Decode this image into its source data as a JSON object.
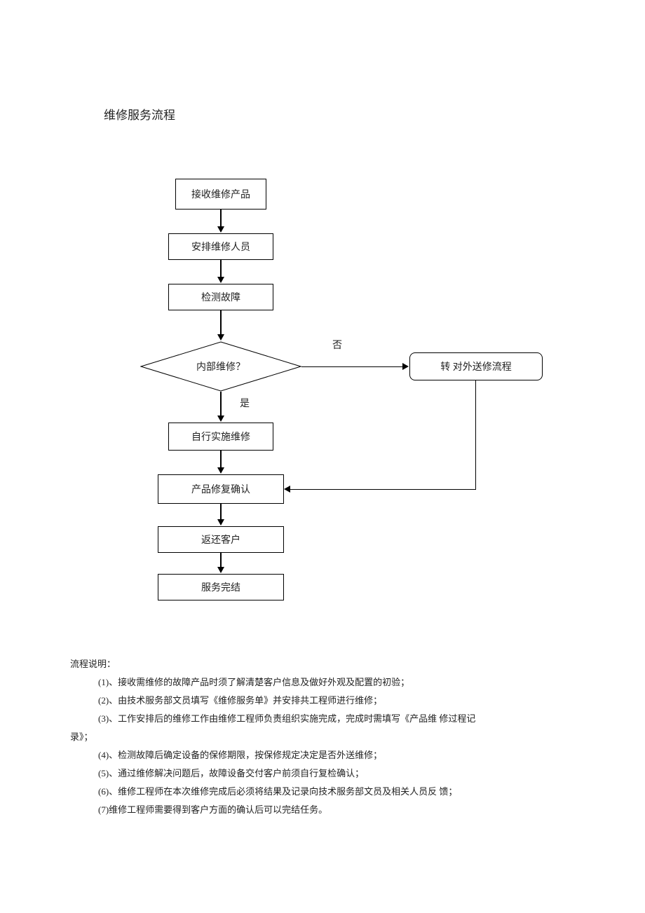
{
  "title": "维修服务流程",
  "chart_data": {
    "type": "flowchart",
    "nodes": [
      {
        "id": "n1",
        "kind": "process",
        "label": "接收维修产品"
      },
      {
        "id": "n2",
        "kind": "process",
        "label": "安排维修人员"
      },
      {
        "id": "n3",
        "kind": "process",
        "label": "检测故障"
      },
      {
        "id": "n4",
        "kind": "decision",
        "label": "内部维修？"
      },
      {
        "id": "n5",
        "kind": "process-rounded",
        "label": "转  对外送修流程"
      },
      {
        "id": "n6",
        "kind": "process",
        "label": "自行实施维修"
      },
      {
        "id": "n7",
        "kind": "process",
        "label": "产品修复确认"
      },
      {
        "id": "n8",
        "kind": "process",
        "label": "返还客户"
      },
      {
        "id": "n9",
        "kind": "process",
        "label": "服务完结"
      }
    ],
    "edges": [
      {
        "from": "n1",
        "to": "n2"
      },
      {
        "from": "n2",
        "to": "n3"
      },
      {
        "from": "n3",
        "to": "n4"
      },
      {
        "from": "n4",
        "to": "n6",
        "label": "是"
      },
      {
        "from": "n4",
        "to": "n5",
        "label": "否"
      },
      {
        "from": "n6",
        "to": "n7"
      },
      {
        "from": "n5",
        "to": "n7"
      },
      {
        "from": "n7",
        "to": "n8"
      },
      {
        "from": "n8",
        "to": "n9"
      }
    ],
    "labels": {
      "yes": "是",
      "no": "否"
    }
  },
  "notes": {
    "heading": "流程说明：",
    "items": [
      "(1)、接收需维修的故障产品时须了解清楚客户信息及做好外观及配置的初验；",
      "(2)、由技术服务部文员填写《维修服务单》并安排共工程师进行维修；",
      "(3)、工作安排后的维修工作由维修工程师负责组织实施完成，完成时需填写《产品维  修过程记",
      "(4)、检测故障后确定设备的保修期限，按保修规定决定是否外送维修；",
      "(5)、通过维修解决问题后，故障设备交付客户前须自行复检确认；",
      "(6)、维修工程师在本次维修完成后必须将结果及记录向技术服务部文员及相关人员反  馈；",
      "(7)维修工程师需要得到客户方面的确认后可以完结任务。"
    ],
    "cont": "录》；"
  }
}
